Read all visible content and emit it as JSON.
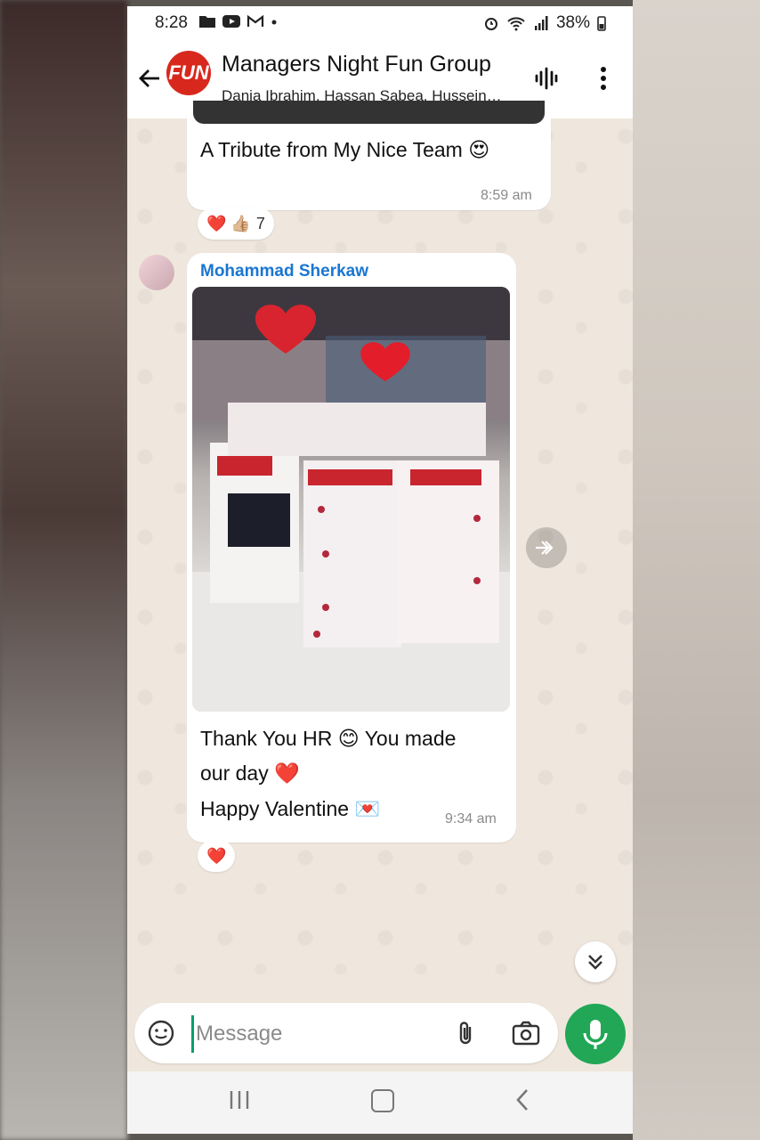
{
  "status_bar": {
    "time": "8:28",
    "battery": "38%"
  },
  "header": {
    "title": "Managers Night Fun Group",
    "subtitle": "Dania Ibrahim, Hassan Sabea, Hussein…",
    "avatar_text": "FUN"
  },
  "messages": [
    {
      "text": "A Tribute from My Nice Team",
      "emoji": "😍",
      "time": "8:59 am",
      "reactions": {
        "emojis": "❤️ 👍🏼",
        "count": "7"
      }
    },
    {
      "sender": "Mohammad Sherkaw",
      "line1": "Thank You HR",
      "emoji1": "😊",
      "line1b": "You made",
      "line2": "our day",
      "emoji2": "❤️",
      "line3": "Happy Valentine",
      "emoji3": "💌",
      "time": "9:34 am",
      "reactions": {
        "emojis": "❤️"
      }
    }
  ],
  "input": {
    "placeholder": "Message"
  },
  "colors": {
    "accent": "#21a755",
    "sender_name": "#1976d2",
    "chat_bg": "#efe7dd"
  }
}
